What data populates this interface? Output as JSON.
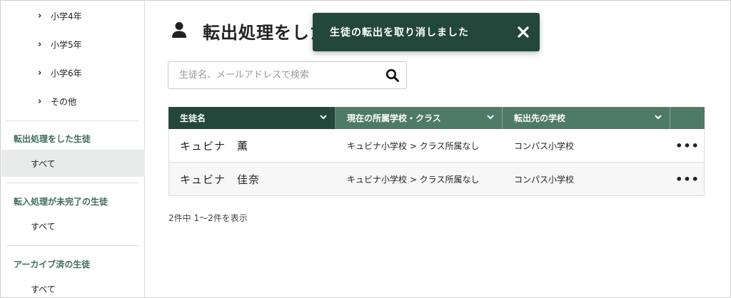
{
  "sidebar": {
    "grades": [
      {
        "label": "小学4年"
      },
      {
        "label": "小学5年"
      },
      {
        "label": "小学6年"
      },
      {
        "label": "その他"
      }
    ],
    "sections": [
      {
        "title": "転出処理をした生徒",
        "item": "すべて"
      },
      {
        "title": "転入処理が未完了の生徒",
        "item": "すべて"
      },
      {
        "title": "アーカイブ済の生徒",
        "item": "すべて"
      }
    ]
  },
  "main": {
    "title": "転出処理をした",
    "search": {
      "placeholder": "生徒名、メールアドレスで検索"
    },
    "table": {
      "columns": [
        "生徒名",
        "現在の所属学校・クラス",
        "転出先の学校"
      ],
      "rows": [
        {
          "name": "キュビナ　薫",
          "current": "キュビナ小学校 > クラス所属なし",
          "destination": "コンパス小学校",
          "menu": "•••"
        },
        {
          "name": "キュビナ　佳奈",
          "current": "キュビナ小学校 > クラス所属なし",
          "destination": "コンパス小学校",
          "menu": "•••"
        }
      ]
    },
    "count": "2件中 1〜2件を表示"
  },
  "toast": {
    "message": "生徒の転出を取り消しました"
  },
  "colors": {
    "accent_dark": "#23473a",
    "accent": "#4e7a68",
    "section_title": "#3f6c5b"
  }
}
